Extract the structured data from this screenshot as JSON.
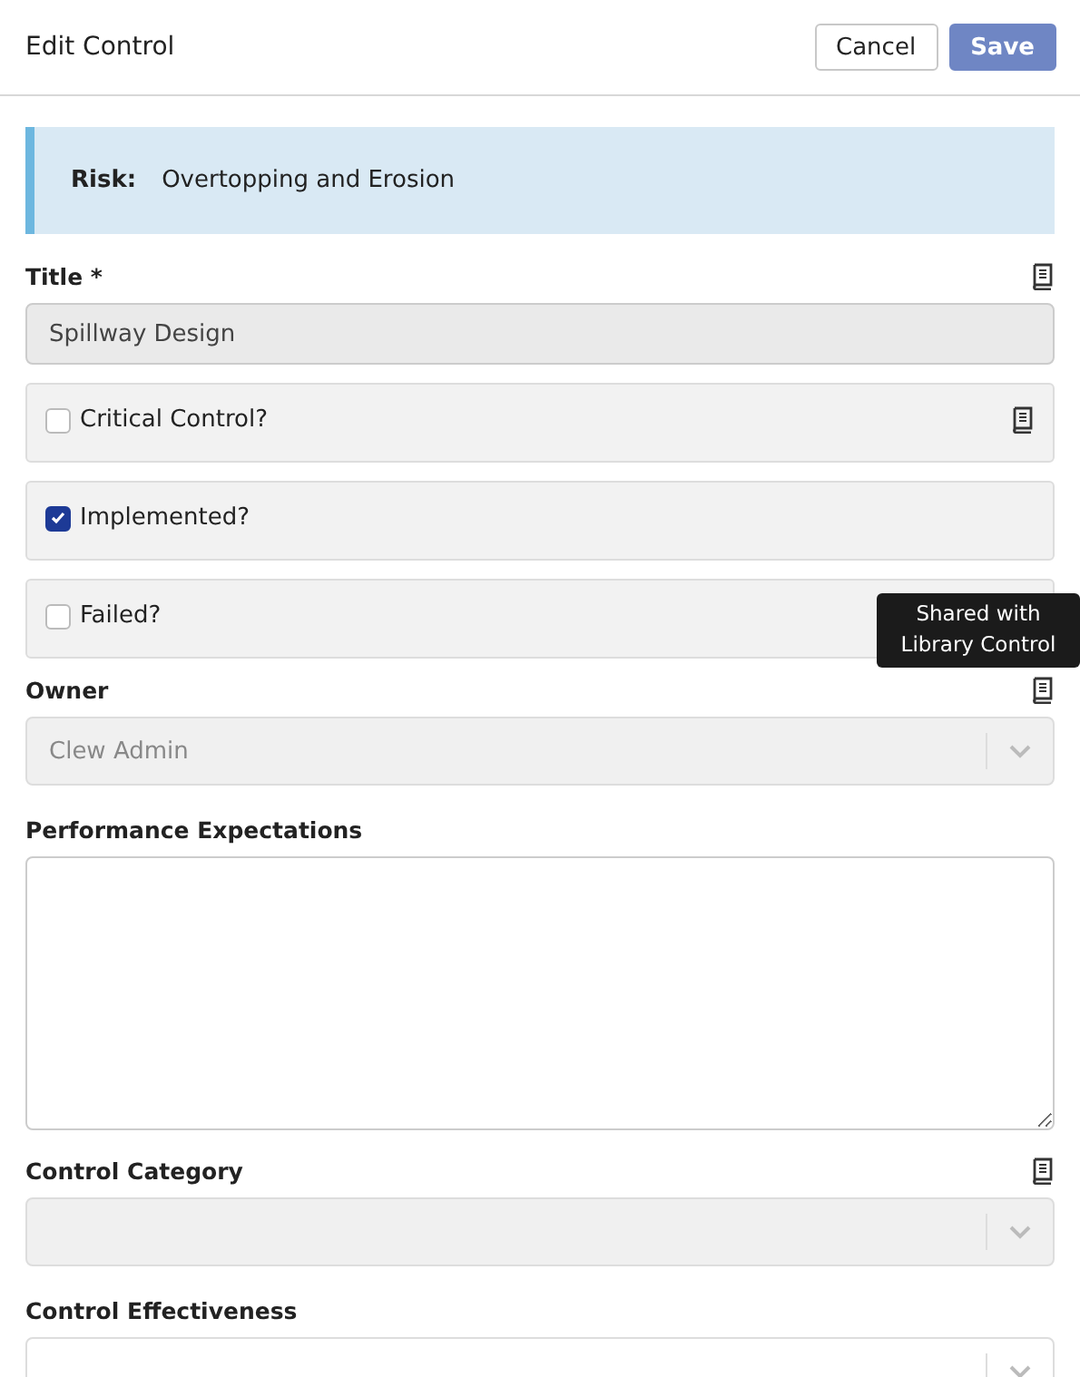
{
  "header": {
    "title": "Edit Control",
    "buttons": [
      {
        "label": "Cancel",
        "kind": "secondary"
      },
      {
        "label": "Save",
        "kind": "primary"
      }
    ]
  },
  "risk": {
    "label": "Risk:",
    "value": "Overtopping and Erosion"
  },
  "fields": [
    {
      "kind": "text",
      "label": "Title *",
      "library": true,
      "value": "Spillway Design",
      "disabled": true
    },
    {
      "kind": "checkbox",
      "label": "Critical Control?",
      "library": true,
      "checked": false
    },
    {
      "kind": "checkbox",
      "label": "Implemented?",
      "library": false,
      "checked": true
    },
    {
      "kind": "checkbox",
      "label": "Failed?",
      "library": false,
      "checked": false,
      "tooltip": "Shared with Library Control"
    },
    {
      "kind": "select",
      "label": "Owner",
      "library": true,
      "value": "Clew Admin",
      "disabled": true
    },
    {
      "kind": "textarea",
      "label": "Performance Expectations",
      "library": false
    },
    {
      "kind": "select",
      "label": "Control Category",
      "library": true,
      "disabled": true
    },
    {
      "kind": "select",
      "label": "Control Effectiveness",
      "library": false,
      "disabled": false
    }
  ]
}
